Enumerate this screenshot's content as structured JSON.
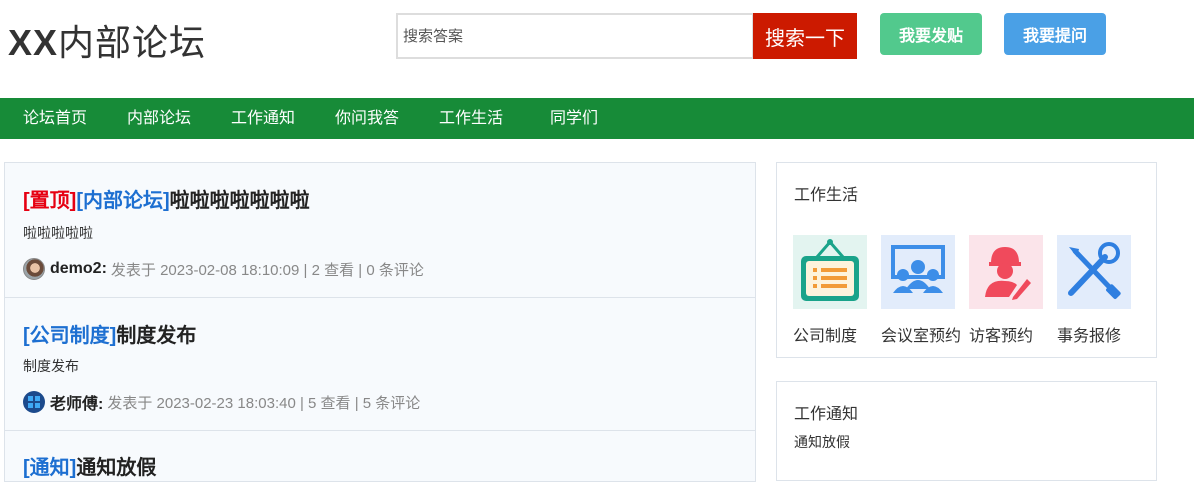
{
  "header": {
    "logo_prefix": "XX",
    "logo_suffix": "内部论坛",
    "search_placeholder": "搜索答案",
    "search_button": "搜索一下",
    "post_button": "我要发贴",
    "ask_button": "我要提问"
  },
  "nav": {
    "items": [
      "论坛首页",
      "内部论坛",
      "工作通知",
      "你问我答",
      "工作生活",
      "同学们"
    ]
  },
  "posts": [
    {
      "tags": [
        "[置顶]",
        "[内部论坛]"
      ],
      "title": "啦啦啦啦啦啦啦",
      "excerpt": "啦啦啦啦啦",
      "author": "demo2:",
      "meta": "发表于  2023-02-08 18:10:09  | 2 查看  | 0 条评论"
    },
    {
      "tags": [
        "[公司制度]"
      ],
      "title": "制度发布",
      "excerpt": "制度发布",
      "author": "老师傅:",
      "meta": "发表于  2023-02-23 18:03:40  | 5 查看  | 5 条评论"
    },
    {
      "tags": [
        "[通知]"
      ],
      "title": "通知放假"
    }
  ],
  "sidebar": {
    "life": {
      "title": "工作生活",
      "services": [
        {
          "label": "公司制度",
          "icon": "notice-board-icon"
        },
        {
          "label": "会议室预约",
          "icon": "meeting-room-icon"
        },
        {
          "label": "访客预约",
          "icon": "visitor-icon"
        },
        {
          "label": "事务报修",
          "icon": "repair-tools-icon"
        }
      ]
    },
    "notice": {
      "title": "工作通知",
      "items": [
        "通知放假"
      ]
    }
  },
  "colors": {
    "nav_bg": "#178b38",
    "search_button": "#cc1a00",
    "post_button": "#52c98d",
    "ask_button": "#4aa0e6",
    "top_tag": "#e60012",
    "category_tag": "#1d6fd1"
  }
}
